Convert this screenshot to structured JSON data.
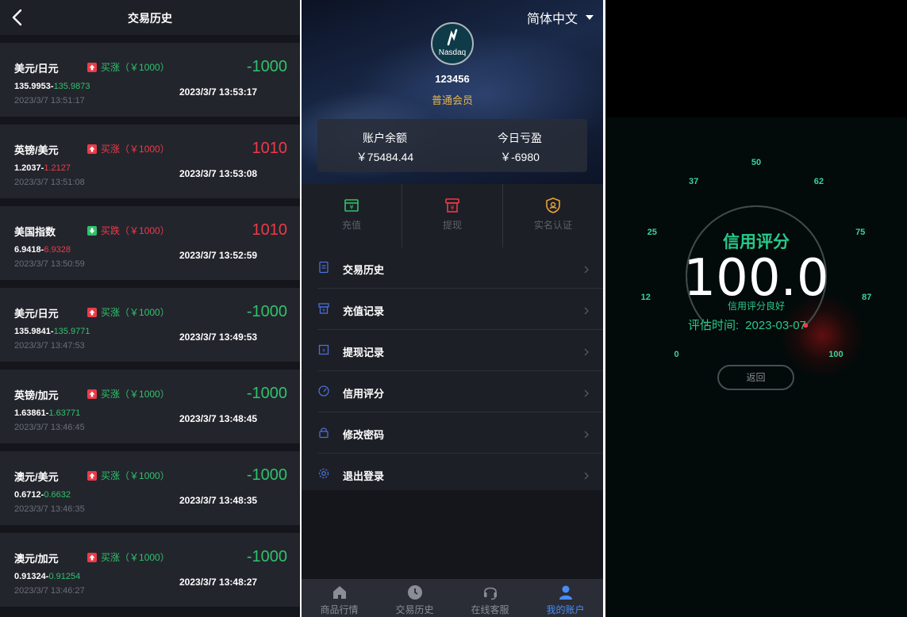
{
  "history": {
    "title": "交易历史",
    "trades": [
      {
        "pair": "美元/日元",
        "direction": "买涨",
        "amount": "（￥1000）",
        "dir_color": "green",
        "arrow": "up",
        "open_price": "135.9953",
        "close_price": "135.9873",
        "price_color": "green",
        "open_time": "2023/3/7 13:51:17",
        "close_time": "2023/3/7 13:53:17",
        "pl": "-1000",
        "pl_color": "green"
      },
      {
        "pair": "英镑/美元",
        "direction": "买涨",
        "amount": "（￥1000）",
        "dir_color": "red",
        "arrow": "up",
        "open_price": "1.2037",
        "close_price": "1.2127",
        "price_color": "red",
        "open_time": "2023/3/7 13:51:08",
        "close_time": "2023/3/7 13:53:08",
        "pl": "1010",
        "pl_color": "red"
      },
      {
        "pair": "美国指数",
        "direction": "买跌",
        "amount": "（￥1000）",
        "dir_color": "red",
        "arrow": "down",
        "open_price": "6.9418",
        "close_price": "6.9328",
        "price_color": "red",
        "open_time": "2023/3/7 13:50:59",
        "close_time": "2023/3/7 13:52:59",
        "pl": "1010",
        "pl_color": "red"
      },
      {
        "pair": "美元/日元",
        "direction": "买涨",
        "amount": "（￥1000）",
        "dir_color": "green",
        "arrow": "up",
        "open_price": "135.9841",
        "close_price": "135.9771",
        "price_color": "green",
        "open_time": "2023/3/7 13:47:53",
        "close_time": "2023/3/7 13:49:53",
        "pl": "-1000",
        "pl_color": "green"
      },
      {
        "pair": "英镑/加元",
        "direction": "买涨",
        "amount": "（￥1000）",
        "dir_color": "green",
        "arrow": "up",
        "open_price": "1.63861",
        "close_price": "1.63771",
        "price_color": "green",
        "open_time": "2023/3/7 13:46:45",
        "close_time": "2023/3/7 13:48:45",
        "pl": "-1000",
        "pl_color": "green"
      },
      {
        "pair": "澳元/美元",
        "direction": "买涨",
        "amount": "（￥1000）",
        "dir_color": "green",
        "arrow": "up",
        "open_price": "0.6712",
        "close_price": "0.6632",
        "price_color": "green",
        "open_time": "2023/3/7 13:46:35",
        "close_time": "2023/3/7 13:48:35",
        "pl": "-1000",
        "pl_color": "green"
      },
      {
        "pair": "澳元/加元",
        "direction": "买涨",
        "amount": "（￥1000）",
        "dir_color": "green",
        "arrow": "up",
        "open_price": "0.91324",
        "close_price": "0.91254",
        "price_color": "green",
        "open_time": "2023/3/7 13:46:27",
        "close_time": "2023/3/7 13:48:27",
        "pl": "-1000",
        "pl_color": "green"
      }
    ]
  },
  "account": {
    "language": "简体中文",
    "avatar_text": "Nasdaq",
    "user_id": "123456",
    "level": "普通会员",
    "balance_label": "账户余额",
    "balance_value": "￥75484.44",
    "today_label": "今日亏盈",
    "today_value": "￥-6980",
    "actions": [
      {
        "label": "充值",
        "icon": "deposit-icon",
        "color": "#2fc26b"
      },
      {
        "label": "提现",
        "icon": "withdraw-icon",
        "color": "#ee3a47"
      },
      {
        "label": "实名认证",
        "icon": "verify-shield-icon",
        "color": "#e8a33b"
      }
    ],
    "menu": [
      {
        "label": "交易历史",
        "icon": "document-icon"
      },
      {
        "label": "充值记录",
        "icon": "deposit-record-icon"
      },
      {
        "label": "提现记录",
        "icon": "withdraw-record-icon"
      },
      {
        "label": "信用评分",
        "icon": "gauge-icon"
      },
      {
        "label": "修改密码",
        "icon": "lock-icon"
      },
      {
        "label": "退出登录",
        "icon": "gear-icon"
      }
    ],
    "tabs": [
      {
        "label": "商品行情",
        "icon": "home-icon",
        "active": false
      },
      {
        "label": "交易历史",
        "icon": "clock-icon",
        "active": false
      },
      {
        "label": "在线客服",
        "icon": "headset-icon",
        "active": false
      },
      {
        "label": "我的账户",
        "icon": "user-icon",
        "active": true
      }
    ],
    "accent_color": "#4a8cf5"
  },
  "credit": {
    "ticks": [
      "0",
      "12",
      "25",
      "37",
      "50",
      "62",
      "75",
      "87",
      "100"
    ],
    "title": "信用评分",
    "score": "100.0",
    "score_fraction": 1.0,
    "status": "信用评分良好",
    "time_label": "评估时间:",
    "time_value": "2023-03-07",
    "back_label": "返回",
    "accent_color": "#29c98a"
  }
}
